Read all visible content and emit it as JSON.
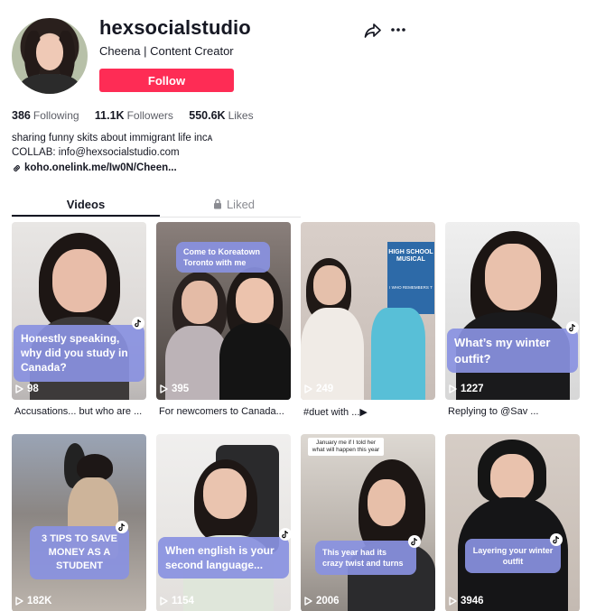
{
  "profile": {
    "username": "hexsocialstudio",
    "subtitle": "Cheena | Content Creator",
    "follow_label": "Follow",
    "stats": {
      "following_count": "386",
      "following_label": "Following",
      "followers_count": "11.1K",
      "followers_label": "Followers",
      "likes_count": "550.6K",
      "likes_label": "Likes"
    },
    "bio_line1": "sharing funny skits about immigrant life inᴄᴀ",
    "bio_line2": "COLLAB: info@hexsocialstudio.com",
    "link": "koho.onelink.me/Iw0N/Cheen..."
  },
  "tabs": {
    "videos": "Videos",
    "liked": "Liked"
  },
  "videos": [
    {
      "caption": "Honestly speaking, why did you study in Canada?",
      "views": "98",
      "description": "Accusations... but who are ..."
    },
    {
      "caption": "Come to Koreatown Toronto with me",
      "views": "395",
      "description": "For newcomers to Canada..."
    },
    {
      "caption": "",
      "views": "249",
      "description": "#duet with ...▶"
    },
    {
      "caption": "What’s my winter outfit?",
      "views": "1227",
      "description": "Replying to @Sav ..."
    },
    {
      "caption": "3 TIPS TO SAVE MONEY AS A STUDENT",
      "views": "182K",
      "description": ""
    },
    {
      "caption": "When english is your second language...",
      "views": "1154",
      "description": ""
    },
    {
      "caption": "This year had its crazy twist and turns",
      "views": "2006",
      "description": "",
      "note": "January me if I told her what will happen this year"
    },
    {
      "caption": "Layering your winter outfit",
      "views": "3946",
      "description": ""
    }
  ],
  "poster_text": {
    "title": "HIGH SCHOOL MUSICAL",
    "sub": "I WHO REMEMBERS T"
  },
  "colors": {
    "accent": "#fe2c55",
    "caption_bg": "#8991e1",
    "text": "#161823",
    "muted": "#8a8b91"
  },
  "icons": [
    "share-icon",
    "more-icon",
    "link-icon",
    "lock-icon",
    "play-icon",
    "tiktok-icon"
  ]
}
